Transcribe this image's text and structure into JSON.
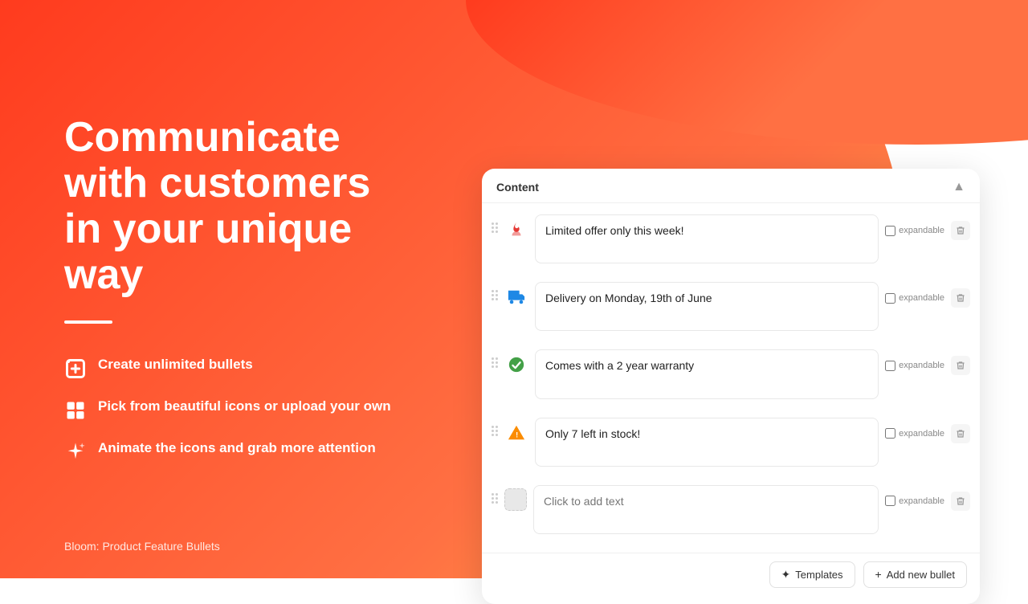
{
  "background": {
    "gradient_from": "#ff3b1e",
    "gradient_to": "#ff7043"
  },
  "left_panel": {
    "title": "Communicate with customers in your unique way",
    "features": [
      {
        "id": "unlimited-bullets",
        "icon": "add-box-icon",
        "text": "Create unlimited bullets"
      },
      {
        "id": "icons-pick",
        "icon": "grid-icon",
        "text": "Pick from beautiful icons or upload your own"
      },
      {
        "id": "animate-icons",
        "icon": "sparkle-icon",
        "text": "Animate the icons and grab more attention"
      }
    ],
    "bottom_label": "Bloom: Product Feature Bullets"
  },
  "content_panel": {
    "header_title": "Content",
    "collapse_icon": "▲",
    "bullets": [
      {
        "id": "bullet-1",
        "text": "Limited offer only this week!",
        "icon_type": "fire",
        "icon_color": "red",
        "expandable": false,
        "placeholder": false
      },
      {
        "id": "bullet-2",
        "text": "Delivery on Monday, 19th of June",
        "icon_type": "truck",
        "icon_color": "blue",
        "expandable": false,
        "placeholder": false
      },
      {
        "id": "bullet-3",
        "text": "Comes with a 2 year warranty",
        "icon_type": "check-circle",
        "icon_color": "green",
        "expandable": false,
        "placeholder": false
      },
      {
        "id": "bullet-4",
        "text": "Only 7 left in stock!",
        "icon_type": "warning",
        "icon_color": "orange",
        "expandable": false,
        "placeholder": false
      },
      {
        "id": "bullet-5",
        "text": "",
        "icon_type": "empty",
        "icon_color": "empty",
        "expandable": false,
        "placeholder": true
      }
    ],
    "footer": {
      "templates_btn": "Templates",
      "add_btn": "Add new bullet",
      "templates_icon": "✦",
      "add_icon": "+"
    }
  }
}
